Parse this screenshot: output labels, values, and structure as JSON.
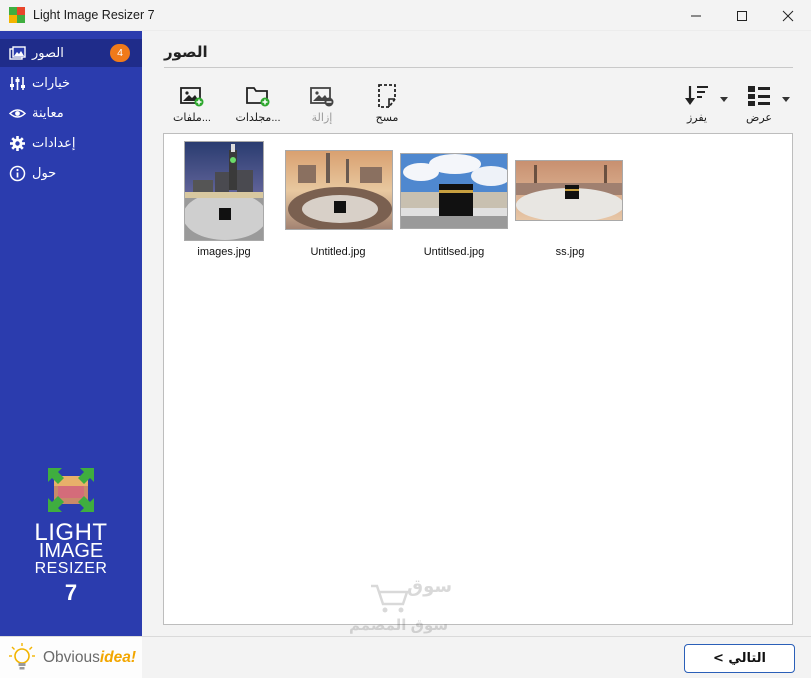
{
  "window": {
    "title": "Light Image Resizer 7",
    "controls": [
      "minimize",
      "maximize",
      "close"
    ]
  },
  "sidebar": {
    "items": [
      {
        "label": "الصور",
        "icon": "images-icon",
        "badge": "4",
        "active": true
      },
      {
        "label": "خيارات",
        "icon": "sliders-icon",
        "active": false
      },
      {
        "label": "معاينة",
        "icon": "eye-icon",
        "active": false
      },
      {
        "label": "إعدادات",
        "icon": "gear-icon",
        "active": false
      },
      {
        "label": "حول",
        "icon": "info-icon",
        "active": false
      }
    ],
    "logo": {
      "line1": "LIGHT",
      "line2": "IMAGE",
      "line3": "RESIZER",
      "line4": "7"
    },
    "brand": {
      "part1": "Obvious",
      "part2": "idea!"
    }
  },
  "main": {
    "page_title": "الصور",
    "toolbar": {
      "files": "ملفات...",
      "folders": "مجلدات...",
      "remove": "إزالة",
      "clear": "مسح",
      "sort": "يفرز",
      "view": "عرض"
    },
    "images": [
      {
        "name": "images.jpg"
      },
      {
        "name": "Untitled.jpg"
      },
      {
        "name": "Untitlsed.jpg"
      },
      {
        "name": "ss.jpg"
      }
    ]
  },
  "footer": {
    "next_label": "< التالي"
  },
  "watermark": {
    "line1": "سوق",
    "line2": "سوق المصمم"
  },
  "colors": {
    "sidebar": "#2b3cae",
    "sidebar_active": "#1f2c8a",
    "badge": "#f07a1a",
    "next_border": "#2a5fb8",
    "add_green": "#2fa82f"
  }
}
